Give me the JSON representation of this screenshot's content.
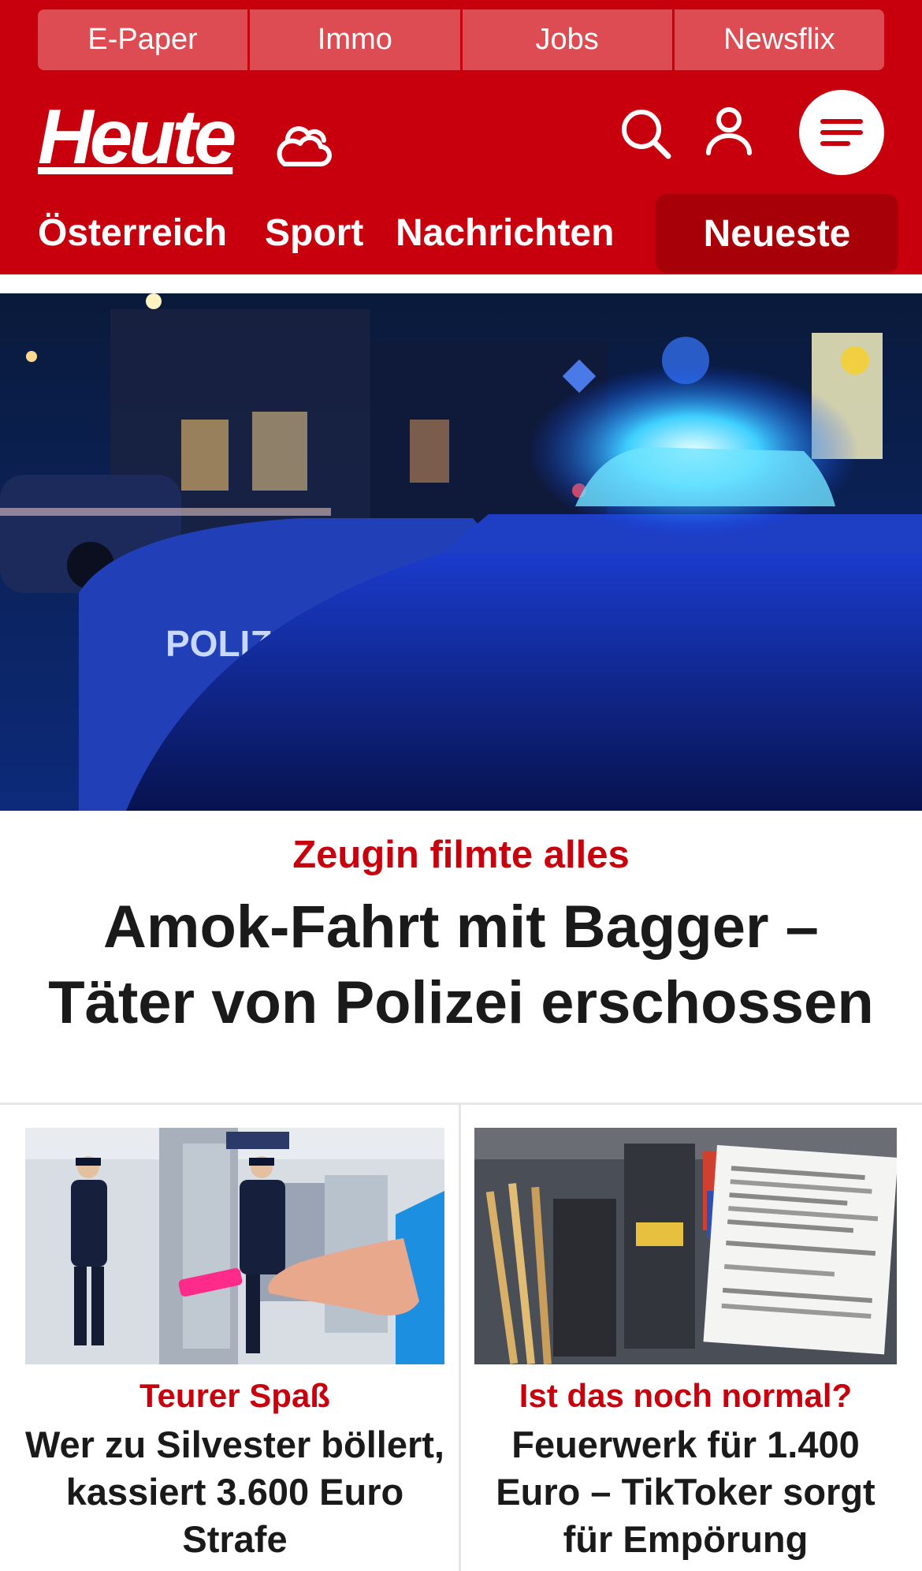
{
  "topnav": {
    "items": [
      {
        "label": "E-Paper"
      },
      {
        "label": "Immo"
      },
      {
        "label": "Jobs"
      },
      {
        "label": "Newsflix"
      }
    ]
  },
  "header": {
    "logo": "Heute",
    "icons": [
      "weather-cloud-icon",
      "search-icon",
      "user-icon",
      "menu-icon"
    ]
  },
  "categories": {
    "items": [
      {
        "label": "Österreich"
      },
      {
        "label": "Sport"
      },
      {
        "label": "Nachrichten"
      }
    ],
    "active": "Neueste"
  },
  "hero": {
    "kicker": "Zeugin filmte alles",
    "headline": "Amok-Fahrt mit Bagger – Täter von Polizei erschossen",
    "image_label": "POLIZ"
  },
  "teasers": [
    {
      "kicker": "Teurer Spaß",
      "title": "Wer zu Silvester böllert, kassiert 3.600 Euro Strafe"
    },
    {
      "kicker": "Ist das noch normal?",
      "title": "Feuerwerk für 1.400 Euro – TikToker sorgt für Empörung"
    }
  ],
  "colors": {
    "brand_red": "#c8000e",
    "topnav_bg": "#dd4c53",
    "active_tab": "#a70009",
    "kicker_red": "#c8000e",
    "headline": "#1a1a1a"
  }
}
